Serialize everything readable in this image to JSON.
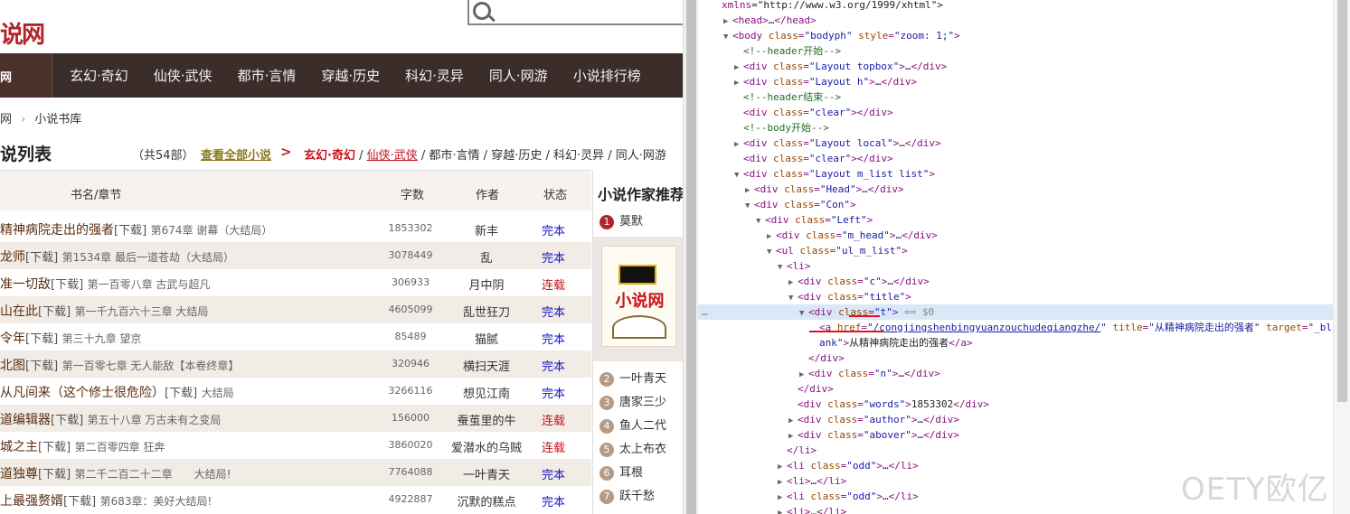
{
  "site": {
    "logo": "说网",
    "nav_home": "网",
    "nav_items": [
      "玄幻·奇幻",
      "仙侠·武侠",
      "都市·言情",
      "穿越·历史",
      "科幻·灵异",
      "同人·网游",
      "小说排行榜"
    ],
    "breadcrumb": [
      "网",
      "小说书库"
    ],
    "list_title": "说列表",
    "count": "（共54部）",
    "view_all": "查看全部小说",
    "arrow": ">",
    "categories": {
      "active": "玄幻·奇幻",
      "sep1": "/",
      "highlighted": "仙侠·武侠",
      "rest": "/ 都市·言情 / 穿越·历史 / 科幻·灵异 / 同人·网游"
    },
    "columns": {
      "title": "书名/章节",
      "words": "字数",
      "author": "作者",
      "status": "状态"
    },
    "books": [
      {
        "name": "精神病院走出的强者",
        "dl": "[下载]",
        "chapter": "第674章 谢幕（大结局）",
        "words": "1853302",
        "author": "新丰",
        "status": "完本"
      },
      {
        "name": "龙师",
        "dl": "[下载]",
        "chapter": "第1534章 最后一道苍劫（大结局）",
        "words": "3078449",
        "author": "乱",
        "status": "完本"
      },
      {
        "name": "准一切敌",
        "dl": "[下载]",
        "chapter": "第一百零八章 古武与超凡",
        "words": "306933",
        "author": "月中阴",
        "status": "连载"
      },
      {
        "name": "山在此",
        "dl": "[下载]",
        "chapter": "第一千九百六十三章 大结局",
        "words": "4605099",
        "author": "乱世狂刀",
        "status": "完本"
      },
      {
        "name": "令年",
        "dl": "[下载]",
        "chapter": "第三十九章 望京",
        "words": "85489",
        "author": "猫腻",
        "status": "完本"
      },
      {
        "name": "北图",
        "dl": "[下载]",
        "chapter": "第一百零七章 无人能敌【本卷终章】",
        "words": "320946",
        "author": "横扫天涯",
        "status": "完本"
      },
      {
        "name": "从凡间来（这个修士很危险）",
        "dl": "[下载]",
        "chapter": "大结局",
        "words": "3266116",
        "author": "想见江南",
        "status": "完本"
      },
      {
        "name": "道编辑器",
        "dl": "[下载]",
        "chapter": "第五十八章 万古未有之变局",
        "words": "156000",
        "author": "蚕茧里的牛",
        "status": "连载"
      },
      {
        "name": "城之主",
        "dl": "[下载]",
        "chapter": "第二百零四章 狂奔",
        "words": "3860020",
        "author": "爱潜水的乌贼",
        "status": "连载"
      },
      {
        "name": "道独尊",
        "dl": "[下载]",
        "chapter": "第二千二百二十二章　　大结局!",
        "words": "7764088",
        "author": "一叶青天",
        "status": "完本"
      },
      {
        "name": "上最强赘婿",
        "dl": "[下载]",
        "chapter": "第683章：美好大结局!",
        "words": "4922887",
        "author": "沉默的糕点",
        "status": "完本"
      }
    ],
    "sidebar": {
      "title": "小说作家推荐",
      "first": {
        "rank": "1",
        "name": "莫默"
      },
      "promo_text": "小说网",
      "list": [
        {
          "rank": "2",
          "name": "一叶青天"
        },
        {
          "rank": "3",
          "name": "唐家三少"
        },
        {
          "rank": "4",
          "name": "鱼人二代"
        },
        {
          "rank": "5",
          "name": "太上布衣"
        },
        {
          "rank": "6",
          "name": "耳根"
        },
        {
          "rank": "7",
          "name": "跃千愁"
        }
      ]
    }
  },
  "colors": {
    "status_done": "#1515c8",
    "status_ongoing": "#c8131b",
    "accent": "#b3242a"
  },
  "devtools": {
    "lines": [
      {
        "indent": 0,
        "tri": "",
        "html": "<span class='tag'>xmlns</span><span class='tx'>=\"http://www.w3.org/1999/xhtml\"&gt;</span>"
      },
      {
        "indent": 1,
        "tri": "▶",
        "html": "<span class='tag'>&lt;head&gt;</span><span class='tx'>…</span><span class='tag'>&lt;/head&gt;</span>"
      },
      {
        "indent": 1,
        "tri": "▼",
        "html": "<span class='tag'>&lt;body </span><span class='an'>class</span><span class='tag'>=</span><span class='av'>\"bodyph\"</span> <span class='an'>style</span><span class='tag'>=</span><span class='av'>\"zoom: 1;\"</span><span class='tag'>&gt;</span>"
      },
      {
        "indent": 2,
        "tri": "",
        "html": "<span class='cm'>&lt;!--header开始--&gt;</span>"
      },
      {
        "indent": 2,
        "tri": "▶",
        "html": "<span class='tag'>&lt;div </span><span class='an'>class</span><span class='tag'>=</span><span class='av'>\"Layout topbox\"</span><span class='tag'>&gt;</span><span class='tx'>…</span><span class='tag'>&lt;/div&gt;</span>"
      },
      {
        "indent": 2,
        "tri": "▶",
        "html": "<span class='tag'>&lt;div </span><span class='an'>class</span><span class='tag'>=</span><span class='av'>\"Layout h\"</span><span class='tag'>&gt;</span><span class='tx'>…</span><span class='tag'>&lt;/div&gt;</span>"
      },
      {
        "indent": 2,
        "tri": "",
        "html": "<span class='cm'>&lt;!--header结束--&gt;</span>"
      },
      {
        "indent": 2,
        "tri": "",
        "html": "<span class='tag'>&lt;div </span><span class='an'>class</span><span class='tag'>=</span><span class='av'>\"clear\"</span><span class='tag'>&gt;&lt;/div&gt;</span>"
      },
      {
        "indent": 2,
        "tri": "",
        "html": "<span class='cm'>&lt;!--body开始--&gt;</span>"
      },
      {
        "indent": 2,
        "tri": "▶",
        "html": "<span class='tag'>&lt;div </span><span class='an'>class</span><span class='tag'>=</span><span class='av'>\"Layout local\"</span><span class='tag'>&gt;</span><span class='tx'>…</span><span class='tag'>&lt;/div&gt;</span>"
      },
      {
        "indent": 2,
        "tri": "",
        "html": "<span class='tag'>&lt;div </span><span class='an'>class</span><span class='tag'>=</span><span class='av'>\"clear\"</span><span class='tag'>&gt;&lt;/div&gt;</span>"
      },
      {
        "indent": 2,
        "tri": "▼",
        "html": "<span class='tag'>&lt;div </span><span class='an'>class</span><span class='tag'>=</span><span class='av'>\"Layout m_list list\"</span><span class='tag'>&gt;</span>"
      },
      {
        "indent": 3,
        "tri": "▶",
        "html": "<span class='tag'>&lt;div </span><span class='an'>class</span><span class='tag'>=</span><span class='av'>\"Head\"</span><span class='tag'>&gt;</span><span class='tx'>…</span><span class='tag'>&lt;/div&gt;</span>"
      },
      {
        "indent": 3,
        "tri": "▼",
        "html": "<span class='tag'>&lt;div </span><span class='an'>class</span><span class='tag'>=</span><span class='av'>\"Con\"</span><span class='tag'>&gt;</span>"
      },
      {
        "indent": 4,
        "tri": "▼",
        "html": "<span class='tag'>&lt;div </span><span class='an'>class</span><span class='tag'>=</span><span class='av'>\"Left\"</span><span class='tag'>&gt;</span>"
      },
      {
        "indent": 5,
        "tri": "▶",
        "html": "<span class='tag'>&lt;div </span><span class='an'>class</span><span class='tag'>=</span><span class='av'>\"m_head\"</span><span class='tag'>&gt;</span><span class='tx'>…</span><span class='tag'>&lt;/div&gt;</span>"
      },
      {
        "indent": 5,
        "tri": "▼",
        "html": "<span class='tag'>&lt;ul </span><span class='an'>class</span><span class='tag'>=</span><span class='av'>\"ul_m_list\"</span><span class='tag'>&gt;</span>"
      },
      {
        "indent": 6,
        "tri": "▼",
        "html": "<span class='tag'>&lt;li&gt;</span>"
      },
      {
        "indent": 7,
        "tri": "▶",
        "html": "<span class='tag'>&lt;div </span><span class='an'>class</span><span class='tag'>=</span><span class='av'>\"c\"</span><span class='tag'>&gt;</span><span class='tx'>…</span><span class='tag'>&lt;/div&gt;</span>"
      },
      {
        "indent": 7,
        "tri": "▼",
        "html": "<span class='tag'>&lt;div </span><span class='an'>class</span><span class='tag'>=</span><span class='av'>\"title\"</span><span class='tag'>&gt;</span>"
      },
      {
        "indent": 8,
        "tri": "▼",
        "sel": true,
        "html": "<span class='tag'>&lt;div </span><span class='an'>class</span><span class='tag'>=</span><span class='av'>\"t\"</span><span class='tag'>&gt;</span> <span class='eq'>== $0</span>"
      },
      {
        "indent": 9,
        "tri": "",
        "html": "<span class='tag'>&lt;a </span><span class='an'>href</span><span class='tag'>=</span><span class='av'>\"<span class='link'>/congjingshenbingyuanzouchudeqiangzhe/</span>\"</span> <span class='an'>title</span><span class='tag'>=</span><span class='av'>\"从精神病院走出的强者\"</span> <span class='an'>target</span><span class='tag'>=</span><span class='av'>\"_bl</span>"
      },
      {
        "indent": 9,
        "tri": "",
        "html": "<span class='av'>ank\"</span><span class='tag'>&gt;</span><span class='tx'>从精神病院走出的强者</span><span class='tag'>&lt;/a&gt;</span>"
      },
      {
        "indent": 8,
        "tri": "",
        "html": "<span class='tag'>&lt;/div&gt;</span>"
      },
      {
        "indent": 8,
        "tri": "▶",
        "html": "<span class='tag'>&lt;div </span><span class='an'>class</span><span class='tag'>=</span><span class='av'>\"n\"</span><span class='tag'>&gt;</span><span class='tx'>…</span><span class='tag'>&lt;/div&gt;</span>"
      },
      {
        "indent": 7,
        "tri": "",
        "html": "<span class='tag'>&lt;/div&gt;</span>"
      },
      {
        "indent": 7,
        "tri": "",
        "html": "<span class='tag'>&lt;div </span><span class='an'>class</span><span class='tag'>=</span><span class='av'>\"words\"</span><span class='tag'>&gt;</span><span class='tx'>1853302</span><span class='tag'>&lt;/div&gt;</span>"
      },
      {
        "indent": 7,
        "tri": "▶",
        "html": "<span class='tag'>&lt;div </span><span class='an'>class</span><span class='tag'>=</span><span class='av'>\"author\"</span><span class='tag'>&gt;</span><span class='tx'>…</span><span class='tag'>&lt;/div&gt;</span>"
      },
      {
        "indent": 7,
        "tri": "▶",
        "html": "<span class='tag'>&lt;div </span><span class='an'>class</span><span class='tag'>=</span><span class='av'>\"abover\"</span><span class='tag'>&gt;</span><span class='tx'>…</span><span class='tag'>&lt;/div&gt;</span>"
      },
      {
        "indent": 6,
        "tri": "",
        "html": "<span class='tag'>&lt;/li&gt;</span>"
      },
      {
        "indent": 6,
        "tri": "▶",
        "html": "<span class='tag'>&lt;li </span><span class='an'>class</span><span class='tag'>=</span><span class='av'>\"odd\"</span><span class='tag'>&gt;</span><span class='tx'>…</span><span class='tag'>&lt;/li&gt;</span>"
      },
      {
        "indent": 6,
        "tri": "▶",
        "html": "<span class='tag'>&lt;li&gt;</span><span class='tx'>…</span><span class='tag'>&lt;/li&gt;</span>"
      },
      {
        "indent": 6,
        "tri": "▶",
        "html": "<span class='tag'>&lt;li </span><span class='an'>class</span><span class='tag'>=</span><span class='av'>\"odd\"</span><span class='tag'>&gt;</span><span class='tx'>…</span><span class='tag'>&lt;/li&gt;</span>"
      },
      {
        "indent": 6,
        "tri": "▶",
        "html": "<span class='tag'>&lt;li&gt;</span><span class='tx'>…</span><span class='tag'>&lt;/li&gt;</span>"
      }
    ],
    "dots": "…"
  },
  "watermark": "OETY欧亿"
}
